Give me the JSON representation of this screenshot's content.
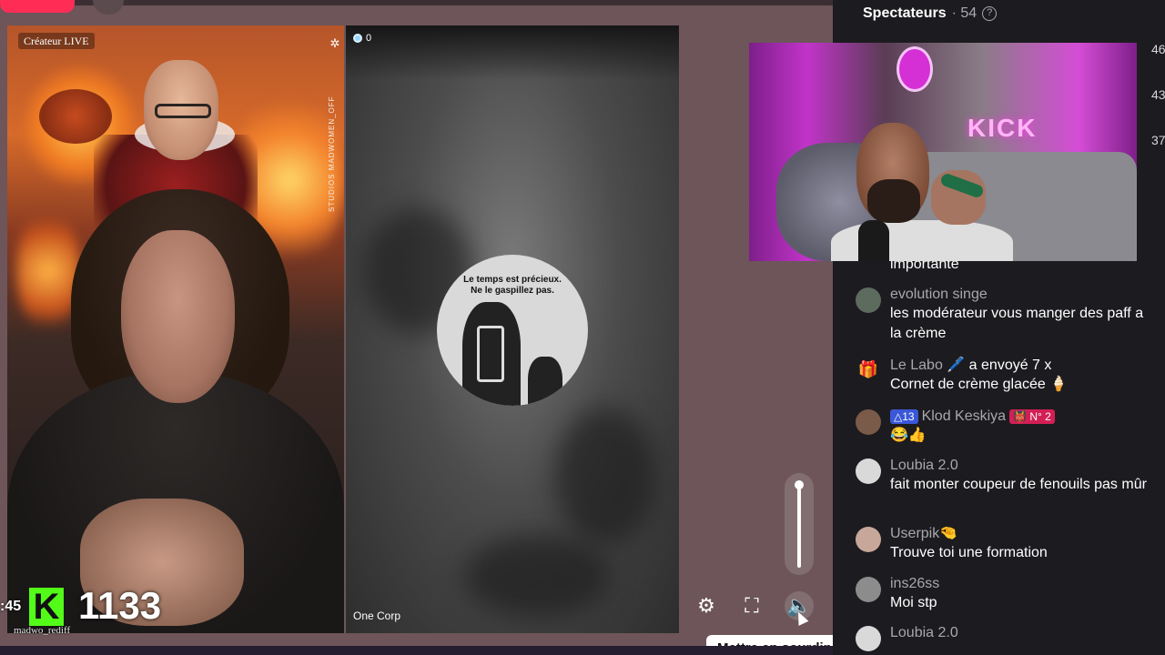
{
  "left_video": {
    "creator_badge": "Créateur LIVE",
    "brand_text": "STUDIOS MADWOMEN_OFF",
    "time_fragment": ":45",
    "counter_value": "1133",
    "username": "madwo_rediff"
  },
  "mid_video": {
    "viewers": "0",
    "avatar_text_line1": "Le temps est précieux.",
    "avatar_text_line2": "Ne le gaspillez pas.",
    "room_label": "One Corp"
  },
  "controls": {
    "settings_icon": "gear-icon",
    "fullscreen_icon": "fullscreen-icon",
    "mute_icon": "speaker-icon",
    "volume_level": 1.0,
    "tooltip": "Mettre en sourdine (M)"
  },
  "pip": {
    "sign_text": "KICK"
  },
  "sidebar": {
    "title": "Spectateurs",
    "count": "· 54",
    "numbers": [
      "46",
      "43",
      "37"
    ],
    "messages": [
      {
        "name": "",
        "text": "importante"
      },
      {
        "name": "evolution singe",
        "text": "les modérateur vous manger des paff a la crème"
      },
      {
        "name": "Le Labo",
        "emoji": "🖊️",
        "action": "a envoyé 7 x",
        "text": "Cornet de crème glacée 🍦"
      },
      {
        "name": "Klod Keskiya",
        "sub_badge": "△13",
        "rank_badge": "👹 N° 2",
        "text": "😂👍"
      },
      {
        "name": "Loubia 2.0",
        "text": "fait monter coupeur de fenouils pas mûr"
      },
      {
        "name": "Userpik",
        "emoji": "🤏",
        "text": "Trouve toi une formation"
      },
      {
        "name": "ins26ss",
        "text": "Moi stp"
      },
      {
        "name": "Loubia 2.0",
        "text": ""
      }
    ]
  },
  "colors": {
    "accent_green": "#53fc18",
    "accent_pink": "#ff2d55",
    "sidebar_bg": "#1c1b1f"
  }
}
